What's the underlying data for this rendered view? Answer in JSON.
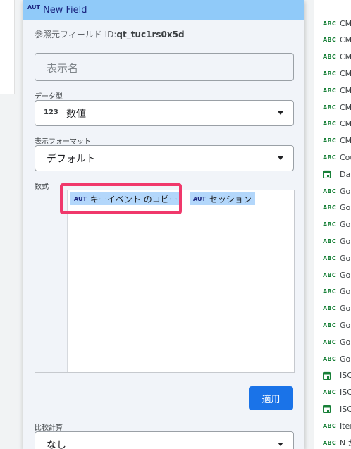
{
  "panel": {
    "aut_tag": "AUT",
    "title": "New Field",
    "source_id_label": "参照元フィールド ID:",
    "source_id_value": "qt_tuc1rs0x5d",
    "name_placeholder": "表示名",
    "data_type_label": "データ型",
    "data_type_icon": "123",
    "data_type_value": "数値",
    "format_label": "表示フォーマット",
    "format_value": "デフォルト",
    "formula_label": "数式",
    "formula": {
      "chip1_tag": "AUT",
      "chip1_text": "キーイベント のコピー",
      "operator": "/",
      "chip2_tag": "AUT",
      "chip2_text": "セッション"
    },
    "apply_label": "適用",
    "comparison_label": "比較計算",
    "comparison_value": "なし"
  },
  "field_list": [
    {
      "type": "ABC",
      "name": "CM"
    },
    {
      "type": "ABC",
      "name": "CM"
    },
    {
      "type": "ABC",
      "name": "CM"
    },
    {
      "type": "ABC",
      "name": "CM"
    },
    {
      "type": "ABC",
      "name": "CM"
    },
    {
      "type": "ABC",
      "name": "CM"
    },
    {
      "type": "ABC",
      "name": "CM"
    },
    {
      "type": "ABC",
      "name": "CM"
    },
    {
      "type": "ABC",
      "name": "Cou"
    },
    {
      "type": "date",
      "name": "Dat"
    },
    {
      "type": "ABC",
      "name": "Go"
    },
    {
      "type": "ABC",
      "name": "Go"
    },
    {
      "type": "ABC",
      "name": "Go"
    },
    {
      "type": "ABC",
      "name": "Go"
    },
    {
      "type": "ABC",
      "name": "Go"
    },
    {
      "type": "ABC",
      "name": "Go"
    },
    {
      "type": "ABC",
      "name": "Go"
    },
    {
      "type": "ABC",
      "name": "Go"
    },
    {
      "type": "ABC",
      "name": "Go"
    },
    {
      "type": "ABC",
      "name": "Go"
    },
    {
      "type": "ABC",
      "name": "Go"
    },
    {
      "type": "date",
      "name": "ISC"
    },
    {
      "type": "ABC",
      "name": "ISC"
    },
    {
      "type": "date",
      "name": "ISC"
    },
    {
      "type": "ABC",
      "name": "Iter"
    },
    {
      "type": "ABC",
      "name": "N か"
    }
  ],
  "colors": {
    "header": "#90caf9",
    "chip": "#b3d7fb",
    "highlight": "#f0386b",
    "apply": "#1a73e8",
    "type_icon": "#188038"
  }
}
